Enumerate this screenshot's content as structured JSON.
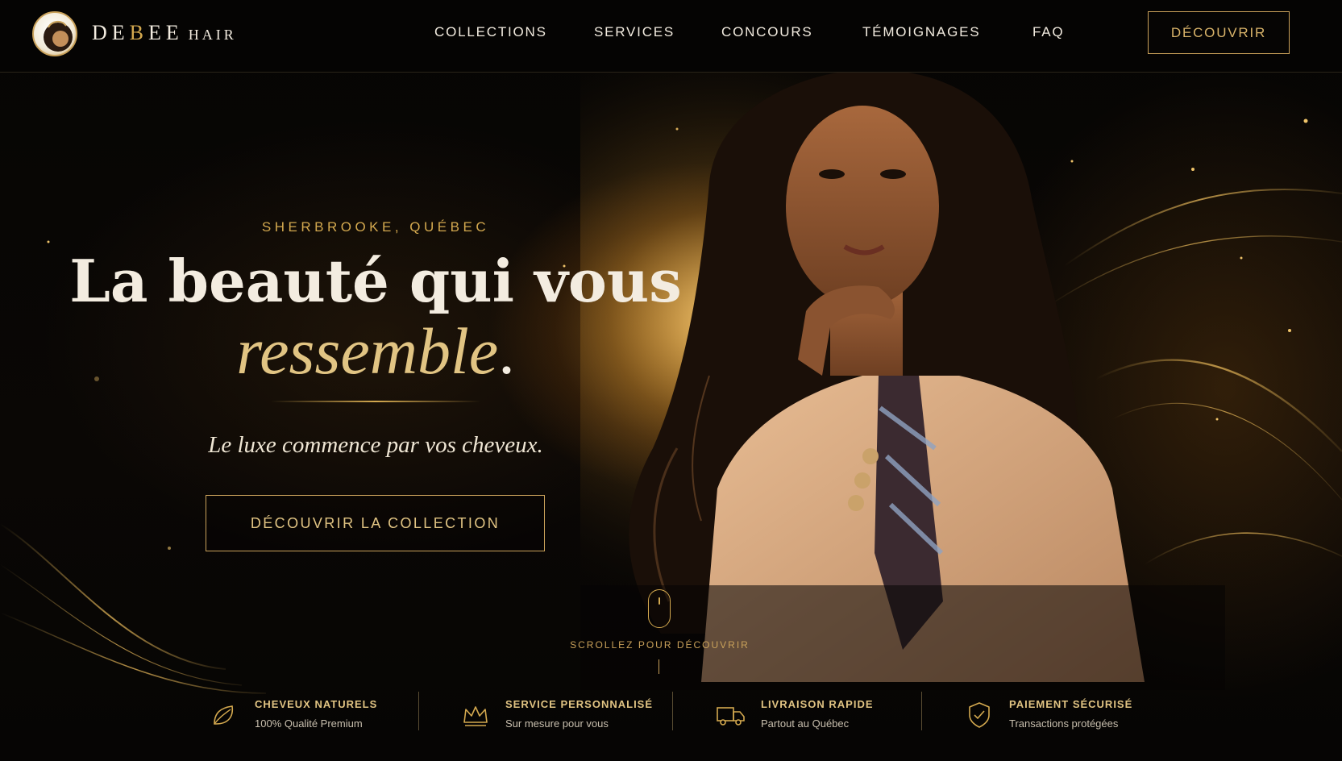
{
  "header": {
    "brand": {
      "name_pre": "DE",
      "name_highlight": "B",
      "name_post": "EE",
      "name_suffix": "HAIR"
    },
    "nav": [
      {
        "label": "COLLECTIONS"
      },
      {
        "label": "SERVICES"
      },
      {
        "label": "CONCOURS"
      },
      {
        "label": "TÉMOIGNAGES"
      },
      {
        "label": "FAQ"
      }
    ],
    "cta_label": "DÉCOUVRIR"
  },
  "hero": {
    "eyebrow": "SHERBROOKE, QUÉBEC",
    "headline_line1": "La beauté qui vous",
    "headline_line2": "ressemble",
    "headline_punct": ".",
    "tagline": "Le luxe commence par vos cheveux.",
    "cta_label": "DÉCOUVRIR LA COLLECTION",
    "scroll_hint": "SCROLLEZ POUR DÉCOUVRIR"
  },
  "features": [
    {
      "icon": "leaf-icon",
      "title": "CHEVEUX NATURELS",
      "subtitle": "100% Qualité Premium"
    },
    {
      "icon": "crown-icon",
      "title": "SERVICE PERSONNALISÉ",
      "subtitle": "Sur mesure pour vous"
    },
    {
      "icon": "truck-icon",
      "title": "LIVRAISON RAPIDE",
      "subtitle": "Partout au Québec"
    },
    {
      "icon": "shield-check-icon",
      "title": "PAIEMENT SÉCURISÉ",
      "subtitle": "Transactions protégées"
    }
  ],
  "colors": {
    "accent_gold": "#d4a94f",
    "background": "#050403",
    "text_light": "#f3ece0"
  }
}
